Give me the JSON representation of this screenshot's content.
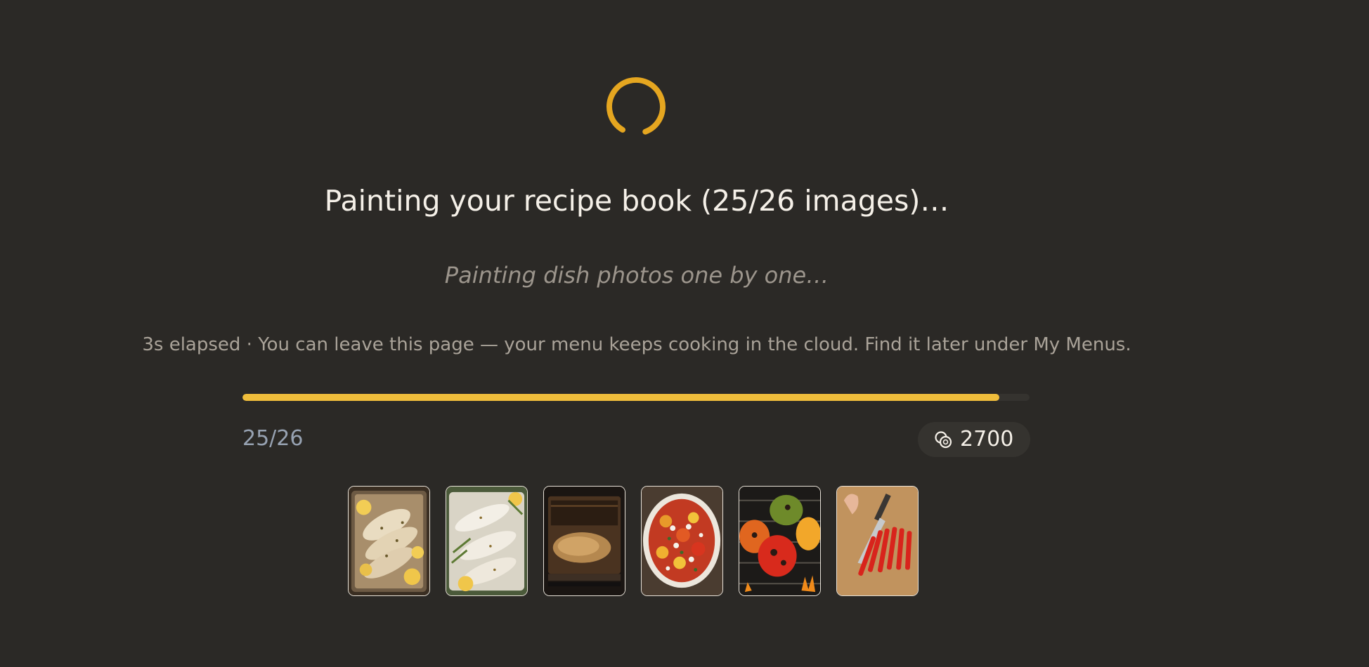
{
  "status": {
    "title": "Painting your recipe book (25/26 images)…",
    "subtitle": "Painting dish photos one by one…",
    "info": "3s elapsed · You can leave this page — your menu keeps cooking in the cloud. Find it later under My Menus."
  },
  "progress": {
    "completed": 25,
    "total": 26,
    "fraction": 0.962,
    "count_label": "25/26"
  },
  "credits": {
    "icon": "coins-icon",
    "value": "2700"
  },
  "colors": {
    "background": "#2b2926",
    "accent": "#efbd3b",
    "spinner": "#e5a620"
  },
  "thumbnails": [
    {
      "name": "thumb-baked-fish-lemon"
    },
    {
      "name": "thumb-fish-fillets-herbs"
    },
    {
      "name": "thumb-fish-in-oven"
    },
    {
      "name": "thumb-pepper-feta-salad"
    },
    {
      "name": "thumb-grilled-peppers"
    },
    {
      "name": "thumb-slicing-red-peppers"
    }
  ]
}
